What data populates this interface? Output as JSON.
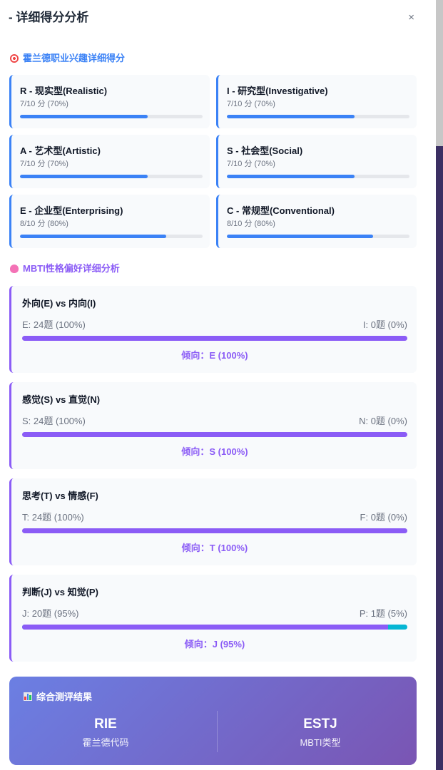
{
  "header": {
    "title": "- 详细得分分析",
    "close": "×"
  },
  "holland": {
    "section_title": "霍兰德职业兴趣详细得分",
    "items": [
      {
        "name": "R - 现实型(Realistic)",
        "score": "7/10 分 (70%)",
        "percent": 70
      },
      {
        "name": "I - 研究型(Investigative)",
        "score": "7/10 分 (70%)",
        "percent": 70
      },
      {
        "name": "A - 艺术型(Artistic)",
        "score": "7/10 分 (70%)",
        "percent": 70
      },
      {
        "name": "S - 社会型(Social)",
        "score": "7/10 分 (70%)",
        "percent": 70
      },
      {
        "name": "E - 企业型(Enterprising)",
        "score": "8/10 分 (80%)",
        "percent": 80
      },
      {
        "name": "C - 常规型(Conventional)",
        "score": "8/10 分 (80%)",
        "percent": 80
      }
    ]
  },
  "mbti": {
    "section_title": "MBTI性格偏好详细分析",
    "items": [
      {
        "title": "外向(E) vs 内向(I)",
        "left": "E: 24题 (100%)",
        "right": "I: 0题 (0%)",
        "percent": 100,
        "tendency": "倾向：E (100%)"
      },
      {
        "title": "感觉(S) vs 直觉(N)",
        "left": "S: 24题 (100%)",
        "right": "N: 0题 (0%)",
        "percent": 100,
        "tendency": "倾向：S (100%)"
      },
      {
        "title": "思考(T) vs 情感(F)",
        "left": "T: 24题 (100%)",
        "right": "F: 0题 (0%)",
        "percent": 100,
        "tendency": "倾向：T (100%)"
      },
      {
        "title": "判断(J) vs 知觉(P)",
        "left": "J: 20题 (95%)",
        "right": "P: 1题 (5%)",
        "percent": 95,
        "tendency": "倾向：J (95%)"
      }
    ]
  },
  "result": {
    "title": "综合测评结果",
    "holland_code": "RIE",
    "holland_label": "霍兰德代码",
    "mbti_type": "ESTJ",
    "mbti_label": "MBTI类型"
  },
  "colors": {
    "holland_accent": "#3b82f6",
    "mbti_accent": "#8b5cf6",
    "mbti_secondary": "#06b6d4"
  }
}
